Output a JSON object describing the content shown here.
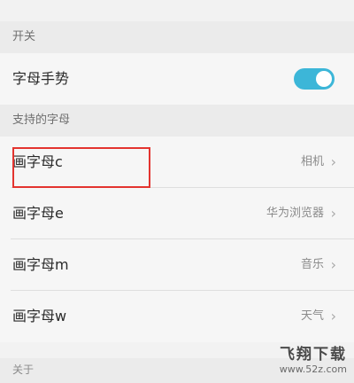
{
  "sections": {
    "switch_header": "开关",
    "supported_header": "支持的字母"
  },
  "gesture_row": {
    "label": "字母手势",
    "toggle_on": true,
    "toggle_color": "#3cb6d8"
  },
  "letters": [
    {
      "label": "画字母c",
      "value": "相机"
    },
    {
      "label": "画字母e",
      "value": "华为浏览器"
    },
    {
      "label": "画字母m",
      "value": "音乐"
    },
    {
      "label": "画字母w",
      "value": "天气"
    }
  ],
  "partial_header": "关于",
  "highlight_color": "#e3342f",
  "watermark": {
    "title": "飞翔下载",
    "url": "www.52z.com"
  }
}
